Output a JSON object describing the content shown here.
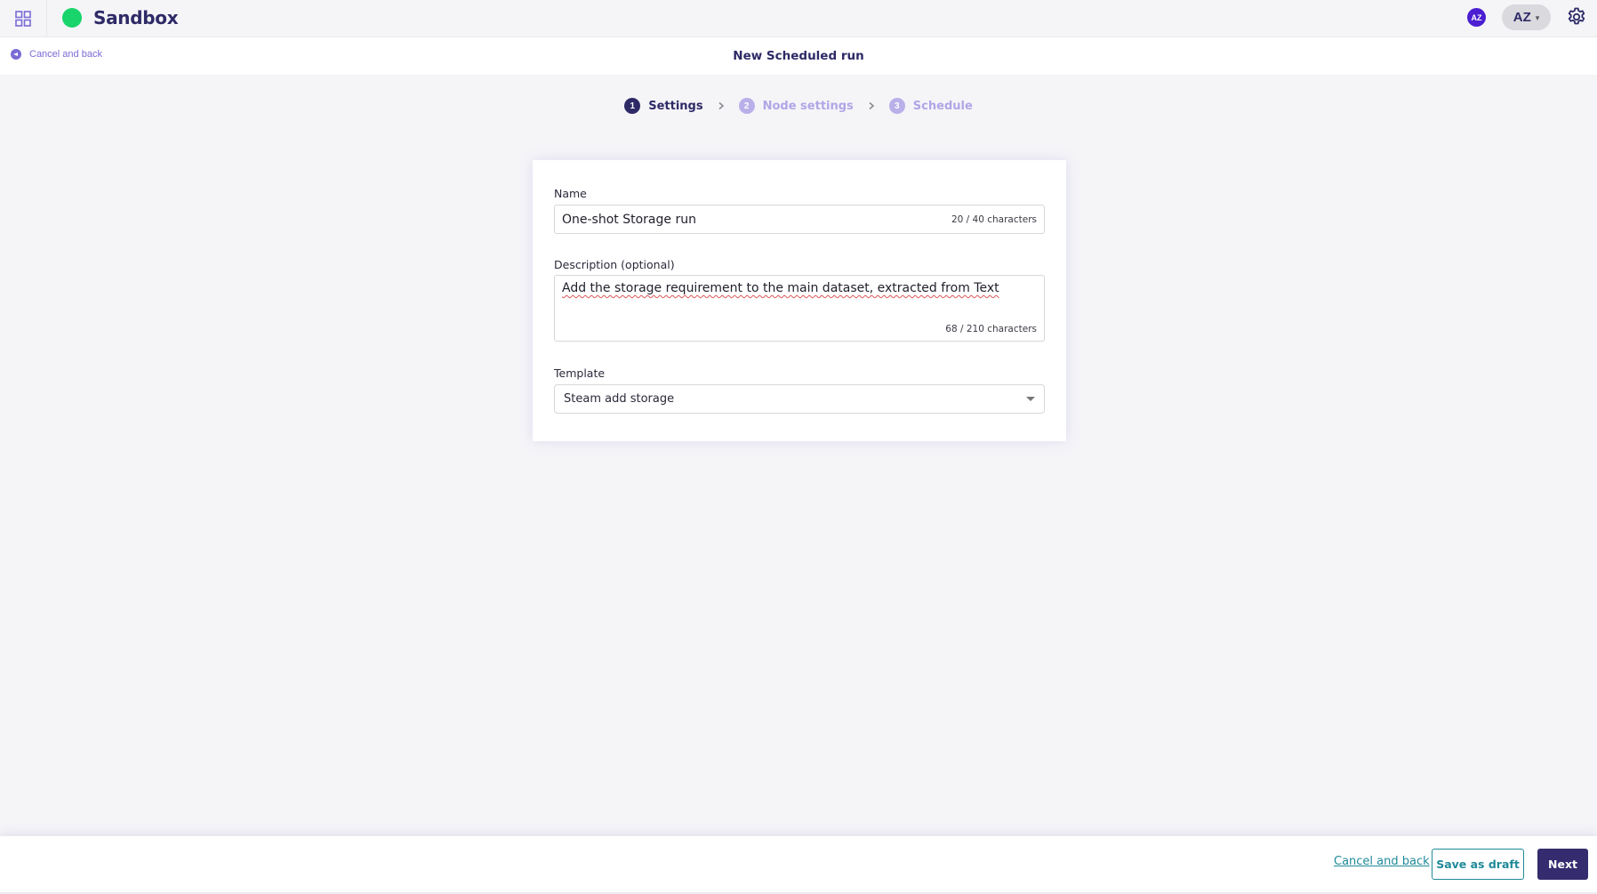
{
  "topbar": {
    "apps_icon": "grid-icon",
    "brand_name": "Sandbox",
    "brand_color": "#18d46a",
    "avatar_initials": "AZ",
    "user_menu_initials": "AZ",
    "user_menu_caret": "▾",
    "settings_icon": "gear-icon"
  },
  "subheader": {
    "back_label": "Cancel and back",
    "back_icon": "arrow-left-circle-icon",
    "title": "New Scheduled run"
  },
  "stepper": {
    "steps": [
      {
        "number": "1",
        "label": "Settings",
        "state": "active"
      },
      {
        "number": "2",
        "label": "Node settings",
        "state": "inactive"
      },
      {
        "number": "3",
        "label": "Schedule",
        "state": "inactive"
      }
    ],
    "separator_icon": "chevron-right-icon"
  },
  "form": {
    "name": {
      "label": "Name",
      "value": "One-shot Storage run",
      "counter": "20 / 40 characters"
    },
    "description": {
      "label": "Description (optional)",
      "value": "Add the storage requirement to the main dataset, extracted from Text",
      "counter": "68 / 210 characters"
    },
    "template": {
      "label": "Template",
      "selected": "Steam add storage"
    }
  },
  "footer": {
    "cancel_label": "Cancel and back",
    "save_draft_label": "Save as draft",
    "next_label": "Next"
  },
  "colors": {
    "primary": "#342c6e",
    "accent_teal": "#1f8a99",
    "link_purple": "#7a6bd6",
    "avatar": "#4b1ed1"
  }
}
